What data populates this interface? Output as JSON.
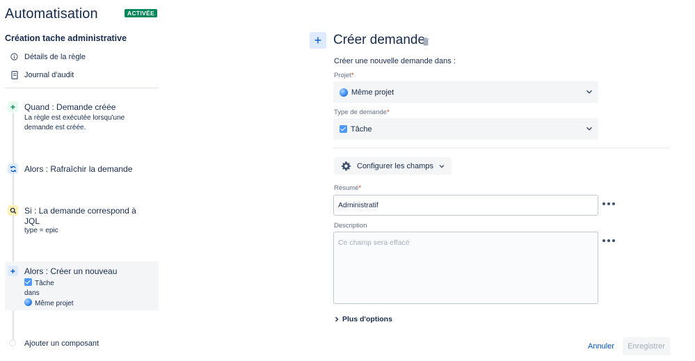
{
  "header": {
    "title": "Automatisation",
    "status": "ACTIVÉE"
  },
  "rule": {
    "name": "Création tache administrative",
    "links": [
      {
        "label": "Détails de la règle",
        "icon": "info-icon"
      },
      {
        "label": "Journal d'audit",
        "icon": "document-icon"
      }
    ]
  },
  "steps": [
    {
      "title": "Quand : Demande créée",
      "sub": [
        "La règle est exécutée lorsqu'une",
        "demande est créée."
      ],
      "icon": "plus-icon",
      "color": "#00875a"
    },
    {
      "title": "Alors : Rafraîchir la demande",
      "icon": "refresh-icon",
      "color": "#0052cc"
    },
    {
      "title": [
        "Si : La demande correspond à",
        "JQL"
      ],
      "sub": [
        "type = epic"
      ],
      "icon": "search-icon",
      "color": "#ff991f"
    },
    {
      "title": "Alors : Créer un nouveau",
      "sub_issue_type": "Tâche",
      "sub_in": "dans",
      "sub_project": "Même projet",
      "icon": "plus-icon",
      "color": "#0052cc"
    }
  ],
  "add_component": "Ajouter un composant",
  "action": {
    "title": "Créer demande",
    "intro": "Créer une nouvelle demande dans :",
    "project_label": "Projet",
    "project_value": "Même projet",
    "issue_type_label": "Type de demande",
    "issue_type_value": "Tâche",
    "required_mark": "*",
    "configure_fields": "Configurer les champs",
    "summary_label": "Résumé",
    "summary_value": "Administratif",
    "description_label": "Description",
    "description_placeholder": "Ce champ sera effacé",
    "more_options": "Plus d'options",
    "cancel": "Annuler",
    "save": "Enregistrer"
  },
  "colors": {
    "accent": "#0052cc",
    "status": "#00875a",
    "required": "#de350b"
  }
}
